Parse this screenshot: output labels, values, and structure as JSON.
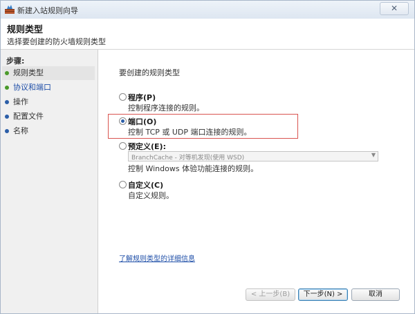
{
  "window": {
    "title": "新建入站规则向导",
    "close_glyph": "✕"
  },
  "header": {
    "title": "规则类型",
    "subtitle": "选择要创建的防火墙规则类型"
  },
  "sidebar": {
    "steps_title": "步骤:",
    "steps": [
      {
        "label": "规则类型",
        "color": "#4a9a2a"
      },
      {
        "label": "协议和端口",
        "color": "#4a9a2a"
      },
      {
        "label": "操作",
        "color": "#2b5ea8"
      },
      {
        "label": "配置文件",
        "color": "#2b5ea8"
      },
      {
        "label": "名称",
        "color": "#2b5ea8"
      }
    ]
  },
  "main": {
    "prompt": "要创建的规则类型",
    "options": [
      {
        "label": "程序(P)",
        "desc": "控制程序连接的规则。",
        "checked": false
      },
      {
        "label": "端口(O)",
        "desc": "控制 TCP 或 UDP 端口连接的规则。",
        "checked": true
      },
      {
        "label": "预定义(E):",
        "desc": "控制 Windows 体验功能连接的规则。",
        "checked": false
      },
      {
        "label": "自定义(C)",
        "desc": "自定义规则。",
        "checked": false
      }
    ],
    "predefined_value": "BranchCache - 对等机发现(使用 WSD)",
    "learn_more": "了解规则类型的详细信息"
  },
  "buttons": {
    "back": "< 上一步(B)",
    "next": "下一步(N) >",
    "cancel": "取消"
  }
}
